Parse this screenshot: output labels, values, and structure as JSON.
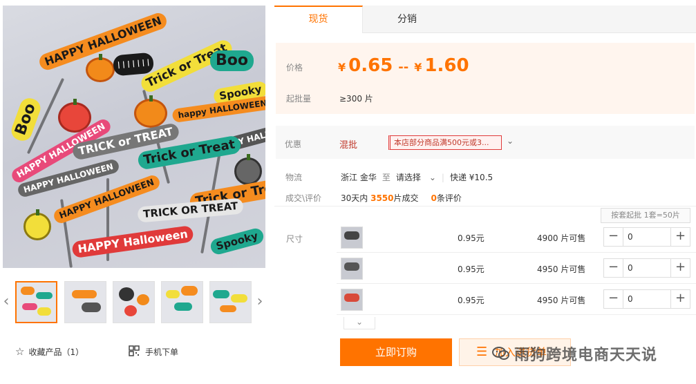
{
  "gallery": {
    "thumb_count": 5,
    "favorite_label": "收藏产品（1）",
    "mobile_order_label": "手机下单",
    "toppers": [
      "Boo",
      "Trick or Treat",
      "Spooky",
      "happy HALLOWEEN",
      "HAPPY HALLOWEEN",
      "TRICK or TREAT",
      "Trick or Treat",
      "Trick or Treat",
      "TRICK OR TREAT",
      "HAPPY Halloween",
      "Spooky",
      "Boo"
    ]
  },
  "tabs": [
    {
      "label": "现货",
      "active": true
    },
    {
      "label": "分销",
      "active": false
    }
  ],
  "price": {
    "label": "价格",
    "currency": "¥",
    "min": "0.65",
    "separator": "--",
    "max": "1.60",
    "moq_label": "起批量",
    "moq_value": "≥300 片"
  },
  "promo": {
    "label": "优惠",
    "link": "混批",
    "tag": "本店部分商品满500元或3..."
  },
  "logistics": {
    "label": "物流",
    "origin": "浙江 金华",
    "to": "至",
    "destination": "请选择",
    "express": "快递 ¥10.5"
  },
  "deals": {
    "label": "成交\\评价",
    "prefix": "30天内",
    "count": "3550",
    "unit": "片成交",
    "reviews": "0",
    "reviews_suffix": "条评价"
  },
  "sku": {
    "label": "尺寸",
    "set_note": "按套起批 1套=50片",
    "rows": [
      {
        "price": "0.95元",
        "stock": "4900 片可售",
        "qty": "0"
      },
      {
        "price": "0.95元",
        "stock": "4950 片可售",
        "qty": "0"
      },
      {
        "price": "0.95元",
        "stock": "4950 片可售",
        "qty": "0"
      }
    ]
  },
  "actions": {
    "order": "立即订购",
    "cart": "加入进货单"
  },
  "watermark": "雨狗跨境电商天天说",
  "colors": {
    "accent": "#ff7300",
    "price_bg": "#fff5ee",
    "promo_red": "#c0392b"
  }
}
